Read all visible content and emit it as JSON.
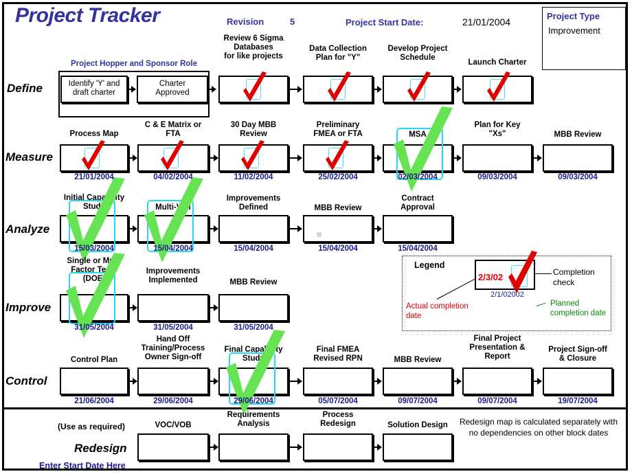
{
  "header": {
    "title": "Project Tracker",
    "revision_label": "Revision",
    "revision_value": "5",
    "start_date_label": "Project Start Date:",
    "start_date_value": "21/01/2004",
    "project_type_label": "Project Type",
    "project_type_value": "Improvement"
  },
  "colors": {
    "title_blue": "#33339e",
    "date_blue": "#1a1a8c",
    "red_check": "#e00000",
    "green_check": "#66e352",
    "cyan_mark": "#24d9f5"
  },
  "hopper": {
    "label": "Project Hopper and Sponsor Role"
  },
  "rows": [
    {
      "phase": "Define",
      "boxes": [
        {
          "label": "Identify 'Y' and\ndraft charter",
          "date": "",
          "check": "none",
          "cyan": "none"
        },
        {
          "label": "Charter\nApproved",
          "date": "",
          "check": "none",
          "cyan": "none"
        },
        {
          "label": "Review  6 Sigma\nDatabases\nfor like projects",
          "date": "",
          "check": "red",
          "cyan": "small"
        },
        {
          "label": "Data Collection\nPlan for \"Y\"",
          "date": "",
          "check": "red",
          "cyan": "small"
        },
        {
          "label": "Develop Project\nSchedule",
          "date": "",
          "check": "red",
          "cyan": "small"
        },
        {
          "label": "Launch Charter",
          "date": "",
          "check": "red",
          "cyan": "small"
        }
      ]
    },
    {
      "phase": "Measure",
      "boxes": [
        {
          "label": "Process Map",
          "date": "21/01/2004",
          "check": "red",
          "cyan": "small"
        },
        {
          "label": "C & E Matrix or\nFTA",
          "date": "04/02/2004",
          "check": "red",
          "cyan": "small"
        },
        {
          "label": "30 Day MBB\nReview",
          "date": "11/02/2004",
          "check": "red",
          "cyan": "small"
        },
        {
          "label": "Preliminary\nFMEA or FTA",
          "date": "25/02/2004",
          "check": "red",
          "cyan": "small"
        },
        {
          "label": "MSA",
          "date": "02/03/2004",
          "check": "green",
          "cyan": "big"
        },
        {
          "label": "Plan for Key\n\"Xs\"",
          "date": "09/03/2004",
          "check": "none",
          "cyan": "none"
        },
        {
          "label": "MBB Review",
          "date": "09/03/2004",
          "check": "none",
          "cyan": "none"
        }
      ]
    },
    {
      "phase": "Analyze",
      "boxes": [
        {
          "label": "Initial Capability\nStudy",
          "date": "15/03/2004",
          "check": "green",
          "cyan": "big"
        },
        {
          "label": "Multi-Vari",
          "date": "15/04/2004",
          "check": "green",
          "cyan": "big"
        },
        {
          "label": "Improvements\nDefined",
          "date": "15/04/2004",
          "check": "none",
          "cyan": "none"
        },
        {
          "label": "MBB Review",
          "date": "15/04/2004",
          "check": "none",
          "cyan": "none"
        },
        {
          "label": "Contract\nApproval",
          "date": "15/04/2004",
          "check": "none",
          "cyan": "none"
        }
      ]
    },
    {
      "phase": "Improve",
      "boxes": [
        {
          "label": "Single or Multi\nFactor Tests\n(DOE)",
          "date": "31/05/2004",
          "check": "green",
          "cyan": "big"
        },
        {
          "label": "Improvements\nImplemented",
          "date": "31/05/2004",
          "check": "none",
          "cyan": "none"
        },
        {
          "label": "MBB Review",
          "date": "31/05/2004",
          "check": "none",
          "cyan": "none"
        }
      ]
    },
    {
      "phase": "Control",
      "boxes": [
        {
          "label": "Control Plan",
          "date": "21/06/2004",
          "check": "none",
          "cyan": "none"
        },
        {
          "label": "Hand Off\nTraining/Process\nOwner Sign-off",
          "date": "29/06/2004",
          "check": "none",
          "cyan": "none"
        },
        {
          "label": "Final Capability\nStudy",
          "date": "29/06/2004",
          "check": "green",
          "cyan": "big"
        },
        {
          "label": "Final FMEA\nRevised RPN",
          "date": "05/07/2004",
          "check": "none",
          "cyan": "none"
        },
        {
          "label": "MBB Review",
          "date": "09/07/2004",
          "check": "none",
          "cyan": "none"
        },
        {
          "label": "Final Project\nPresentation &\nReport",
          "date": "09/07/2004",
          "check": "none",
          "cyan": "none"
        },
        {
          "label": "Project Sign-off\n& Closure",
          "date": "19/07/2004",
          "check": "none",
          "cyan": "none"
        }
      ]
    },
    {
      "phase": "Redesign",
      "use_as_required": "(Use as required)",
      "start_date_link": "Enter Start Date Here",
      "note": "Redesign map is calculated separately with no dependencies on other block dates",
      "boxes": [
        {
          "label": "VOC/VOB",
          "date": "",
          "check": "none",
          "cyan": "none"
        },
        {
          "label": "Requirements\nAnalysis",
          "date": "",
          "check": "none",
          "cyan": "none"
        },
        {
          "label": "Process\nRedesign",
          "date": "",
          "check": "none",
          "cyan": "none"
        },
        {
          "label": "Solution Design",
          "date": "",
          "check": "none",
          "cyan": "none"
        }
      ]
    }
  ],
  "legend": {
    "title": "Legend",
    "actual_date": "2/3/02",
    "planned_date": "2/1/02002",
    "completion_check_label": "Completion\ncheck",
    "actual_label": "Actual completion\ndate",
    "planned_label": "Planned\ncompletion date"
  }
}
